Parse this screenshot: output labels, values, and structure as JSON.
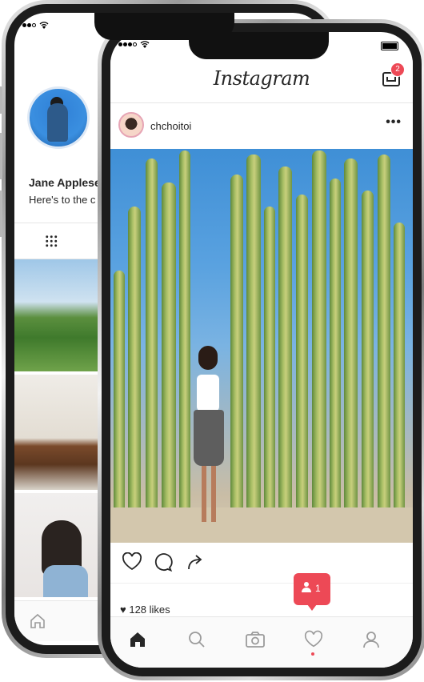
{
  "back_phone": {
    "profile": {
      "name": "Jane Applese",
      "bio": "Here's to the c"
    }
  },
  "front_phone": {
    "app_title": "Instagram",
    "inbox_badge": "2",
    "post": {
      "username": "chchoitoi",
      "more_label": "•••",
      "likes": "128 likes"
    },
    "activity_popup": {
      "count": "1"
    },
    "tabs": [
      "home",
      "search",
      "camera",
      "activity",
      "profile"
    ]
  },
  "colors": {
    "accent": "#ed4956",
    "text": "#262626",
    "divider": "#e6e6e6"
  }
}
